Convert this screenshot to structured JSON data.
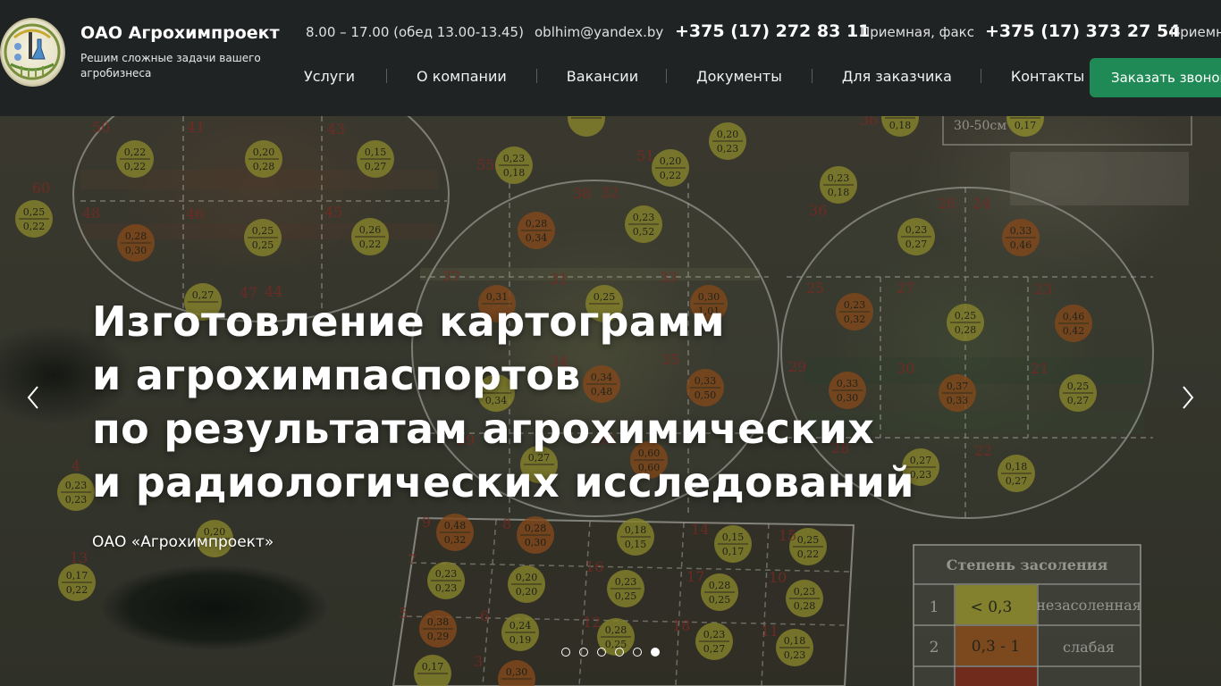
{
  "header": {
    "company_name": "ОАО Агрохимпроект",
    "tagline": "Решим сложные задачи вашего агробизнеса",
    "hours": "8.00 – 17.00 (обед 13.00-13.45)",
    "email": "oblhim@yandex.by",
    "phone_main": "+375 (17) 272 83 11",
    "reception_label": "Приемная, факс",
    "phone_fax": "+375 (17) 373 27 54",
    "reception_label_2": "Приемн",
    "call_button": "Заказать звонок"
  },
  "nav": {
    "items": [
      {
        "label": "Услуги"
      },
      {
        "label": "О компании"
      },
      {
        "label": "Вакансии"
      },
      {
        "label": "Документы"
      },
      {
        "label": "Для заказчика"
      },
      {
        "label": "Контакты"
      }
    ]
  },
  "hero": {
    "title_lines": [
      "Изготовление картограмм",
      "и агрохимпаспортов",
      "по результатам агрохимических",
      "и радиологических исследований"
    ],
    "subtitle": "ОАО «Агрохимпроект»",
    "slides_total": 6,
    "active_slide": 6
  },
  "map": {
    "legend_title": "Степень засоления",
    "legend_rows": [
      {
        "num": "1",
        "range": "< 0,3",
        "label": "незасоленная",
        "color": "#c9c43a"
      },
      {
        "num": "2",
        "range": "0,3 - 1",
        "label": "слабая",
        "color": "#c0641e"
      }
    ],
    "depth_label": "30-50см",
    "plot_labels": [
      "50",
      "41",
      "43",
      "60",
      "48",
      "46",
      "45",
      "55",
      "51",
      "38",
      "32",
      "26",
      "24",
      "25",
      "27",
      "23",
      "37",
      "31",
      "33",
      "47",
      "44",
      "34",
      "35",
      "29",
      "30",
      "21",
      "28",
      "22",
      "39",
      "36",
      "36",
      "36",
      "9",
      "8",
      "14",
      "15",
      "16",
      "10",
      "7",
      "6",
      "12",
      "17",
      "11",
      "18",
      "5",
      "13",
      "4",
      "3"
    ],
    "colors": {
      "yellow": "#bfba38",
      "orange": "#b8611f",
      "red_label": "#a8322a"
    }
  },
  "colors": {
    "header_bg": "#1f2323",
    "accent": "#1f8a55"
  }
}
